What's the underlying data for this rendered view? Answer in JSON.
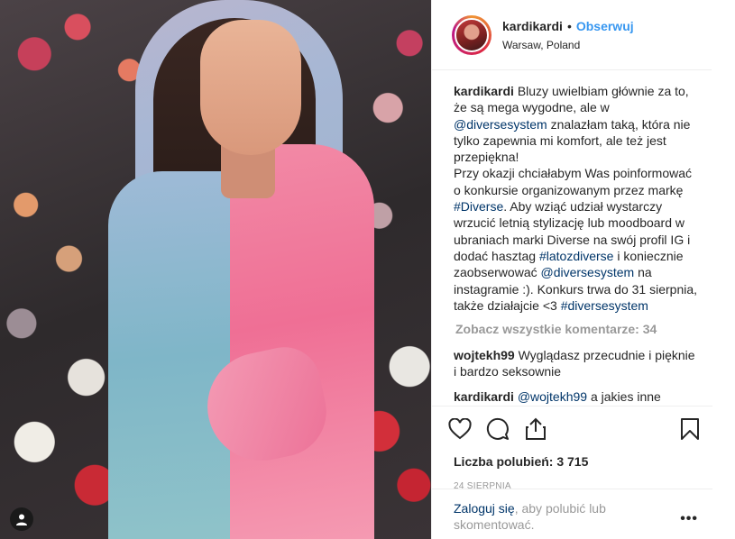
{
  "header": {
    "username": "kardikardi",
    "dot": "•",
    "follow_label": "Obserwuj",
    "location": "Warsaw, Poland"
  },
  "caption": {
    "user": "kardikardi",
    "parts": [
      {
        "t": " Bluzy uwielbiam głównie za to, że są mega wygodne, ale w ",
        "link": false
      },
      {
        "t": "@diversesystem",
        "link": true
      },
      {
        "t": " znalazłam taką, która nie tylko zapewnia mi komfort, ale też jest przepiękna!",
        "link": false
      },
      {
        "t": "\nPrzy okazji chciałabym Was poinformować o konkursie organizowanym przez markę ",
        "link": false
      },
      {
        "t": "#Diverse",
        "link": true
      },
      {
        "t": ". Aby wziąć udział wystarczy wrzucić letnią stylizację lub moodboard w ubraniach marki Diverse na swój profil IG i dodać hasztag ",
        "link": false
      },
      {
        "t": "#latozdiverse",
        "link": true
      },
      {
        "t": " i koniecznie zaobserwować ",
        "link": false
      },
      {
        "t": "@diversesystem",
        "link": true
      },
      {
        "t": " na instagramie :). Konkurs trwa do 31 sierpnia, także działajcie <3 ",
        "link": false
      },
      {
        "t": "#diversesystem",
        "link": true
      }
    ]
  },
  "view_all_comments": "Zobacz wszystkie komentarze: 34",
  "comments": [
    {
      "user": "wojtekh99",
      "parts": [
        {
          "t": " Wyglądasz przecudnie i pięknie i bardzo seksownie",
          "link": false
        }
      ]
    },
    {
      "user": "kardikardi",
      "parts": [
        {
          "t": " ",
          "link": false
        },
        {
          "t": "@wojtekh99",
          "link": true
        },
        {
          "t": " a jakies inne komplementy masz w zanadrzu, bo to juz wiem 🙈🙏🏼",
          "link": false
        }
      ]
    }
  ],
  "likes": "Liczba polubień: 3 715",
  "date": "24 SIERPNIA",
  "login": {
    "link_label": "Zaloguj się",
    "rest": ", aby polubić lub skomentować."
  },
  "more_label": "•••",
  "icons": [
    "heart-icon",
    "comment-icon",
    "share-icon",
    "bookmark-icon",
    "user-tag-icon"
  ],
  "colors": {
    "accent": "#3897f0",
    "link": "#003569",
    "muted": "#999999"
  }
}
